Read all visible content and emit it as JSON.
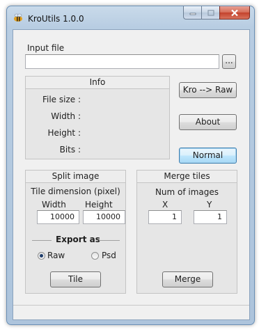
{
  "window": {
    "title": "KroUtils 1.0.0"
  },
  "input_file": {
    "label": "Input file",
    "value": "",
    "browse_label": "..."
  },
  "info": {
    "title": "Info",
    "file_size_label": "File size :",
    "width_label": "Width :",
    "height_label": "Height :",
    "bits_label": "Bits :"
  },
  "buttons": {
    "kro_raw": "Kro --> Raw",
    "about": "About",
    "normal": "Normal",
    "tile": "Tile",
    "merge": "Merge"
  },
  "split": {
    "title": "Split image",
    "tile_dimension_label": "Tile dimension (pixel)",
    "width_label": "Width",
    "height_label": "Height",
    "width_value": "10000",
    "height_value": "10000",
    "export_label": "Export as",
    "raw_label": "Raw",
    "psd_label": "Psd",
    "selected": "Raw"
  },
  "merge": {
    "title": "Merge tiles",
    "num_images_label": "Num of images",
    "x_label": "X",
    "y_label": "Y",
    "x_value": "1",
    "y_value": "1"
  }
}
